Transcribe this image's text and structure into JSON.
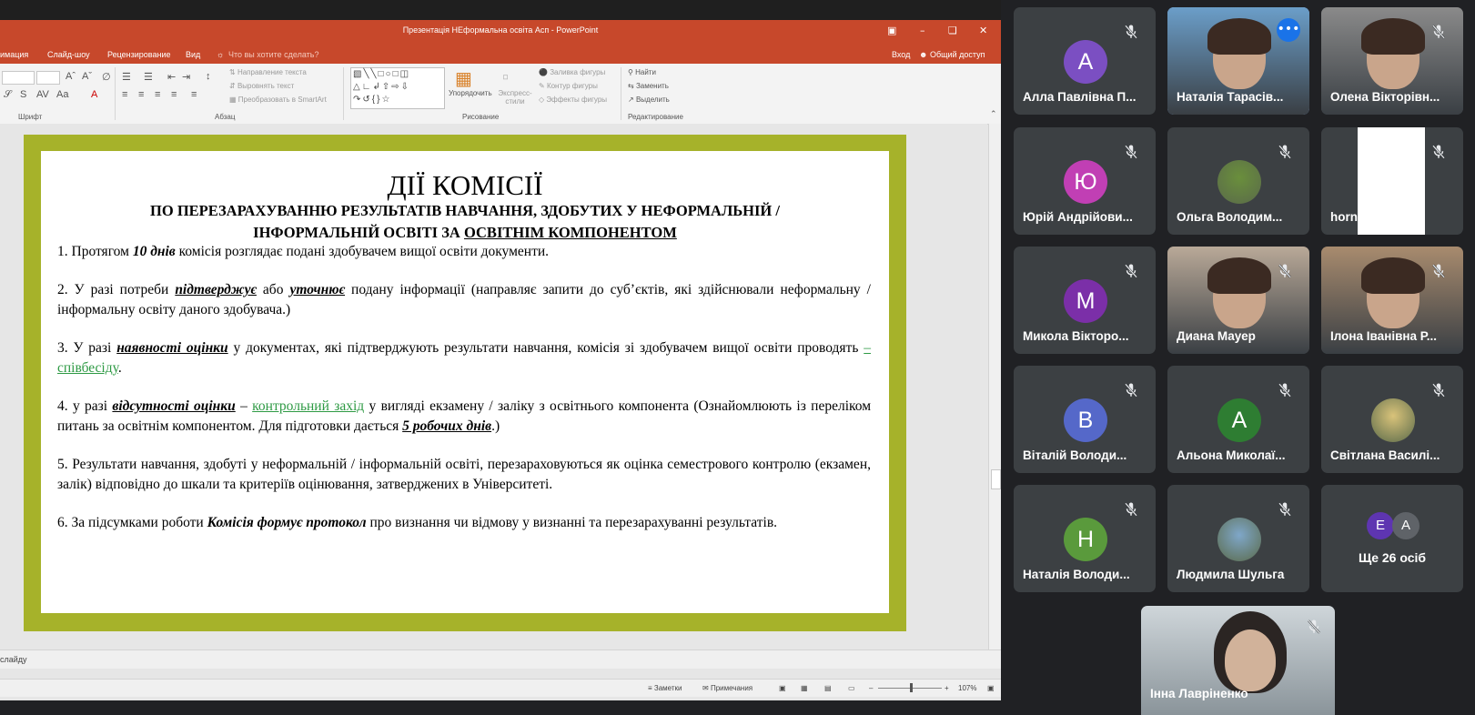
{
  "ppt": {
    "window_title": "Презентація НЕформальна освіта Асп - PowerPoint",
    "menu": [
      "имация",
      "Слайд-шоу",
      "Рецензирование",
      "Вид",
      "Что вы хотите сделать?"
    ],
    "signin": "Вход",
    "share": "Общий доступ",
    "ribbon": {
      "font_group": "Шрифт",
      "paragraph_group": "Абзац",
      "drawing_group": "Рисование",
      "editing_group": "Редактирование",
      "text_direction": "Направление текста",
      "align_text": "Выровнять текст",
      "convert_smartart": "Преобразовать в SmartArt",
      "arrange": "Упорядочить",
      "quick_styles": "Экспресс-стили",
      "shape_fill": "Заливка фигуры",
      "shape_outline": "Контур фигуры",
      "shape_effects": "Эффекты фигуры",
      "find": "Найти",
      "replace": "Заменить",
      "select": "Выделить"
    },
    "slide": {
      "title": "ДІЇ КОМІСІЇ",
      "subtitle_line1": "ПО ПЕРЕЗАРАХУВАННЮ РЕЗУЛЬТАТІВ НАВЧАННЯ,  ЗДОБУТИХ У НЕФОРМАЛЬНІЙ /",
      "subtitle_line2a": "ІНФОРМАЛЬНІЙ ОСВІТІ ЗА",
      "subtitle_line2b": "ОСВІТНІМ КОМПОНЕНТОМ",
      "p1a": "1. Протягом ",
      "p1b": "10 днів",
      "p1c": " комісія розглядає  подані здобувачем вищої освіти документи.",
      "p2a": "2. У разі потреби ",
      "p2b": "підтверджує",
      "p2c": " або ",
      "p2d": "уточнює",
      "p2e": " подану інформації (направляє запити до суб’єктів, які здійснювали неформальну / інформальну освіту даного здобувача.)",
      "p3a": "3. У разі ",
      "p3b": "наявності оцінки",
      "p3c": " у документах, які підтверджують  результати навчання, комісія зі здобувачем вищої освіти проводять ",
      "p3d": "– співбесіду",
      "p3e": ".",
      "p4a": "4. у разі ",
      "p4b": "відсутності оцінки",
      "p4c": " – ",
      "p4d": "контрольний захід",
      "p4e": " у вигляді екзамену / заліку з освітнього компонента (Ознайомлюють із переліком питань за освітнім компонентом. Для підготовки дається ",
      "p4f": "5 робочих днів",
      "p4g": ".)",
      "p5": "5. Результати навчання, здобуті у неформальній / інформальній освіті, перезараховуються як оцінка семестрового контролю (екзамен, залік) відповідно до шкали та критеріїв оцінювання, затверджених в Університеті.",
      "p6a": "6. За підсумками роботи ",
      "p6b": "Комісія формує протокол",
      "p6c": " про визнання чи відмову у визнанні та перезарахуванні результатів."
    },
    "status_left": "слайду",
    "status_notes": "Заметки",
    "status_comments": "Примечания",
    "zoom": "107%"
  },
  "meet": {
    "participants": [
      {
        "name": "Алла Павлівна П...",
        "initial": "А",
        "color": "#7b4fc2"
      },
      {
        "name": "Наталія Тарасів...",
        "initial": "",
        "color": "#6b9ec9"
      },
      {
        "name": "Олена Вікторівн...",
        "initial": "",
        "color": "#8a8a8a"
      },
      {
        "name": "Юрій Андрійови...",
        "initial": "Ю",
        "color": "#c13fb4"
      },
      {
        "name": "Ольга Володим...",
        "initial": "",
        "color": "#6a8f3c"
      },
      {
        "name": "hornet hornet",
        "initial": "",
        "color": "#ffffff"
      },
      {
        "name": "Микола Вікторо...",
        "initial": "М",
        "color": "#7b2fa8"
      },
      {
        "name": "Диана Мауер",
        "initial": "",
        "color": "#b9a998"
      },
      {
        "name": "Ілона Іванівна Р...",
        "initial": "",
        "color": "#a88b6e"
      },
      {
        "name": "Віталій Володи...",
        "initial": "В",
        "color": "#5568c9"
      },
      {
        "name": "Альона Миколаї...",
        "initial": "А",
        "color": "#2e7d32"
      },
      {
        "name": "Світлана Василі...",
        "initial": "",
        "color": "#d9c37a"
      },
      {
        "name": "Наталія Володи...",
        "initial": "Н",
        "color": "#5a9a3c"
      },
      {
        "name": "Людмила Шульга",
        "initial": "",
        "color": "#7fa7c9"
      }
    ],
    "more_label": "Ще 26 осіб",
    "more_initials": [
      "Е",
      "А"
    ],
    "self_name": "Інна Лавріненко"
  }
}
